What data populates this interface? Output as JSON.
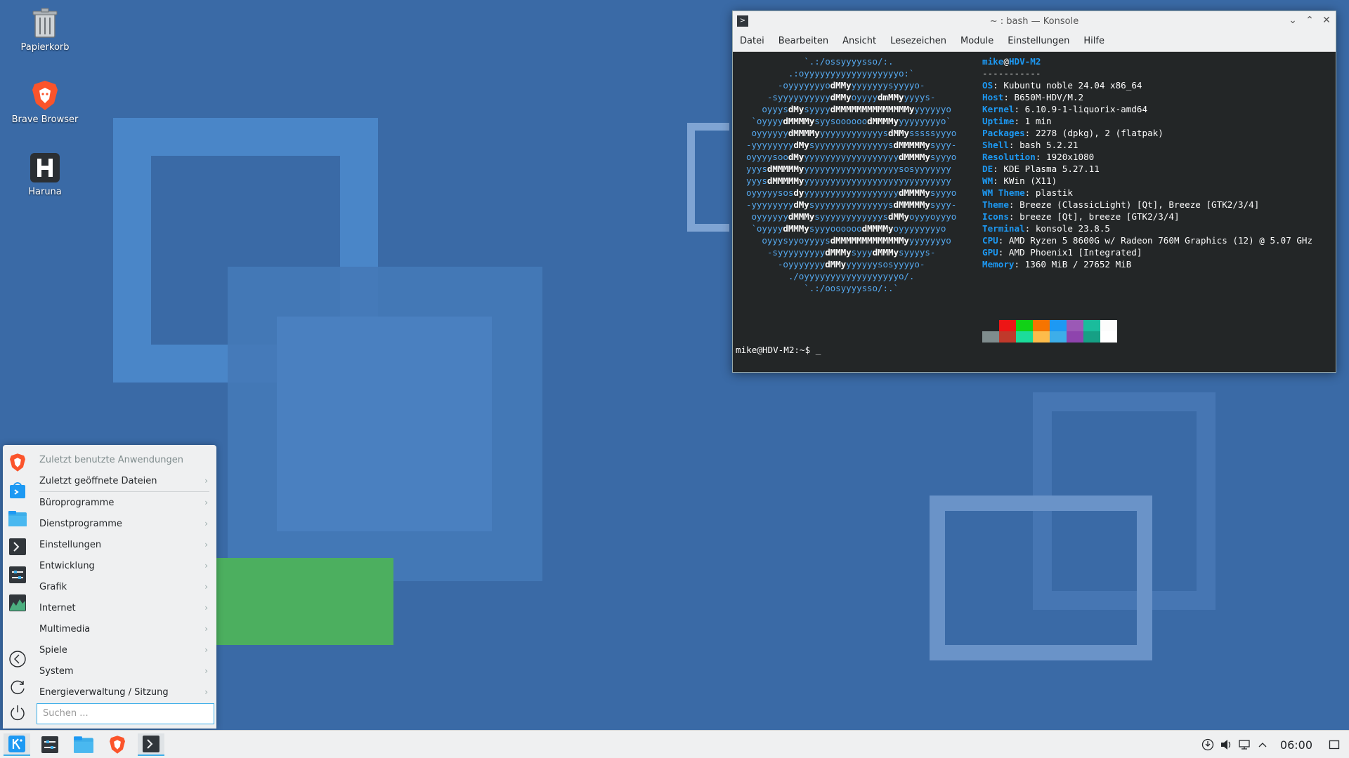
{
  "desktop": {
    "icons": [
      {
        "label": "Papierkorb",
        "icon": "trash-icon"
      },
      {
        "label": "Brave Browser",
        "icon": "brave-lion-icon"
      },
      {
        "label": "Haruna",
        "icon": "haruna-icon"
      }
    ]
  },
  "konsole": {
    "title": "~ : bash — Konsole",
    "menu": [
      "Datei",
      "Bearbeiten",
      "Ansicht",
      "Lesezeichen",
      "Module",
      "Einstellungen",
      "Hilfe"
    ],
    "user": "mike",
    "host": "HDV-M2",
    "separator": "-----------",
    "info": [
      {
        "key": "OS",
        "value": "Kubuntu noble 24.04 x86_64"
      },
      {
        "key": "Host",
        "value": "B650M-HDV/M.2"
      },
      {
        "key": "Kernel",
        "value": "6.10.9-1-liquorix-amd64"
      },
      {
        "key": "Uptime",
        "value": "1 min"
      },
      {
        "key": "Packages",
        "value": "2278 (dpkg), 2 (flatpak)"
      },
      {
        "key": "Shell",
        "value": "bash 5.2.21"
      },
      {
        "key": "Resolution",
        "value": "1920x1080"
      },
      {
        "key": "DE",
        "value": "KDE Plasma 5.27.11"
      },
      {
        "key": "WM",
        "value": "KWin (X11)"
      },
      {
        "key": "WM Theme",
        "value": "plastik"
      },
      {
        "key": "Theme",
        "value": "Breeze (ClassicLight) [Qt], Breeze [GTK2/3/4]"
      },
      {
        "key": "Icons",
        "value": "breeze [Qt], breeze [GTK2/3/4]"
      },
      {
        "key": "Terminal",
        "value": "konsole 23.8.5"
      },
      {
        "key": "CPU",
        "value": "AMD Ryzen 5 8600G w/ Radeon 760M Graphics (12) @ 5.07 GHz"
      },
      {
        "key": "GPU",
        "value": "AMD Phoenix1 [Integrated]"
      },
      {
        "key": "Memory",
        "value": "1360 MiB / 27652 MiB"
      }
    ],
    "palette_top": [
      "#232627",
      "#ed1515",
      "#11d116",
      "#f67400",
      "#1d99f3",
      "#9b59b6",
      "#1abc9c",
      "#fcfcfc"
    ],
    "palette_bottom": [
      "#7f8c8d",
      "#c0392b",
      "#1cdc9a",
      "#fdbc4b",
      "#3daee9",
      "#8e44ad",
      "#16a085",
      "#ffffff"
    ],
    "prompt": "mike@HDV-M2:~$ _"
  },
  "startmenu": {
    "header": "Zuletzt benutzte Anwendungen",
    "items": [
      "Zuletzt geöffnete Dateien",
      "Büroprogramme",
      "Dienstprogramme",
      "Einstellungen",
      "Entwicklung",
      "Grafik",
      "Internet",
      "Multimedia",
      "Spiele",
      "System",
      "Energieverwaltung / Sitzung"
    ],
    "search_placeholder": "Suchen ..."
  },
  "taskbar": {
    "clock": "06:00"
  },
  "colors": {
    "accent": "#3daee9",
    "konsole_bg": "#232627",
    "ascii_blue": "#55a8ee",
    "key_blue": "#1d99f3"
  }
}
